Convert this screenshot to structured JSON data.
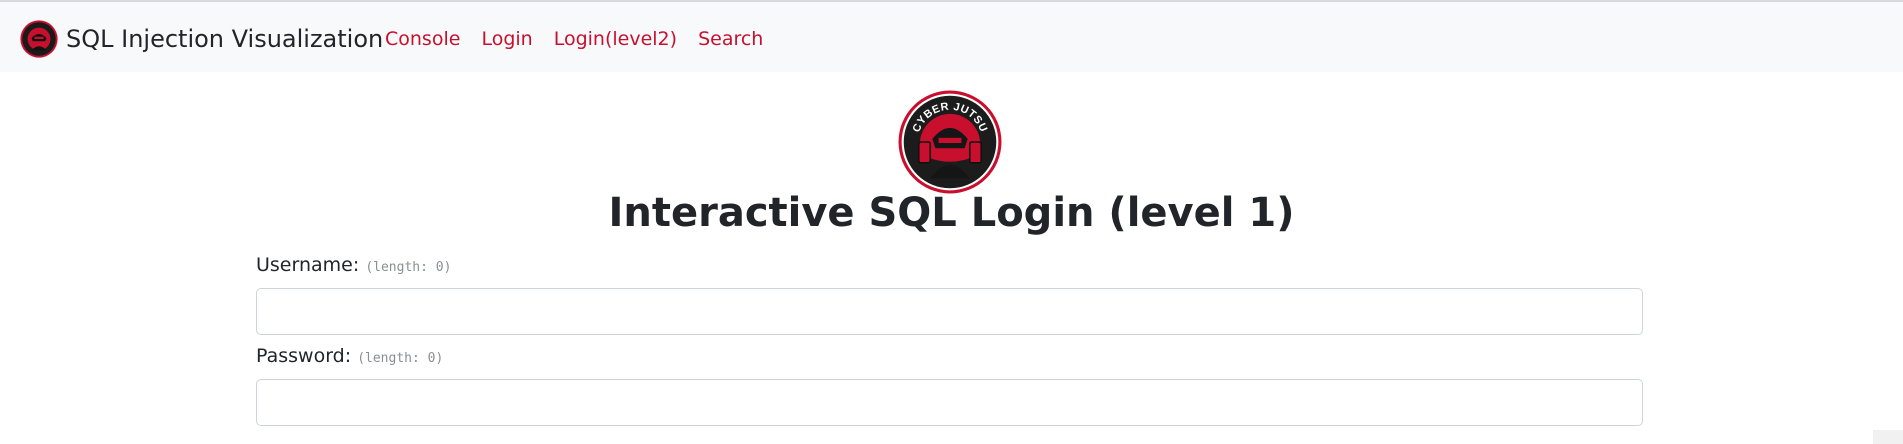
{
  "navbar": {
    "brand_name": "SQL Injection Visualization",
    "links": [
      {
        "label": "Console"
      },
      {
        "label": "Login"
      },
      {
        "label": "Login(level2)"
      },
      {
        "label": "Search"
      }
    ],
    "link_color": "#c8102e"
  },
  "logo": {
    "text": "CYBER JUTSU",
    "accent_color": "#c8102e"
  },
  "main": {
    "title": "Interactive SQL Login (level 1)"
  },
  "form": {
    "username": {
      "label": "Username:",
      "length_hint": "(length: 0)",
      "value": ""
    },
    "password": {
      "label": "Password:",
      "length_hint": "(length: 0)",
      "value": ""
    }
  }
}
